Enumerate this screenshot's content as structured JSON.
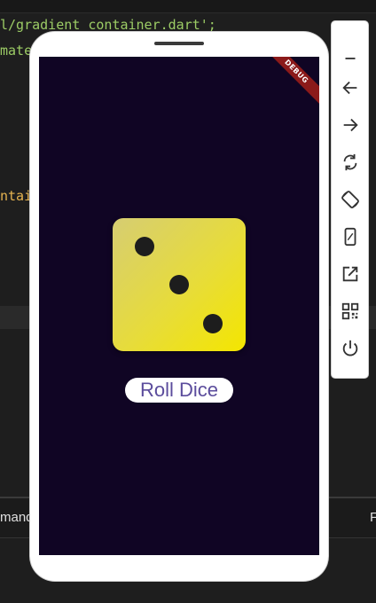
{
  "editor": {
    "code_lines": [
      {
        "text": "l/gradient_container.dart';",
        "color": "#9ccc65"
      },
      {
        "text": "mate",
        "color": "#9ccc65"
      },
      {
        "text": "ntai",
        "color": "#e6b450"
      }
    ],
    "terminal_left_label": "mand",
    "terminal_right_label": "F"
  },
  "app": {
    "debug_banner": "DEBUG",
    "dice_value": 3,
    "roll_button_label": "Roll Dice",
    "colors": {
      "screen_bg": "#100524",
      "dice_gradient_start": "#d6cd72",
      "dice_gradient_end": "#f4e600",
      "button_text": "#5b4c9c"
    }
  },
  "toolbar": {
    "items": [
      {
        "icon": "minimize-icon"
      },
      {
        "icon": "back-arrow-icon"
      },
      {
        "icon": "forward-arrow-icon"
      },
      {
        "icon": "rotate-icon"
      },
      {
        "icon": "screen-rotate-icon"
      },
      {
        "icon": "device-icon"
      },
      {
        "icon": "open-external-icon"
      },
      {
        "icon": "qr-code-icon"
      },
      {
        "icon": "power-icon"
      }
    ]
  }
}
